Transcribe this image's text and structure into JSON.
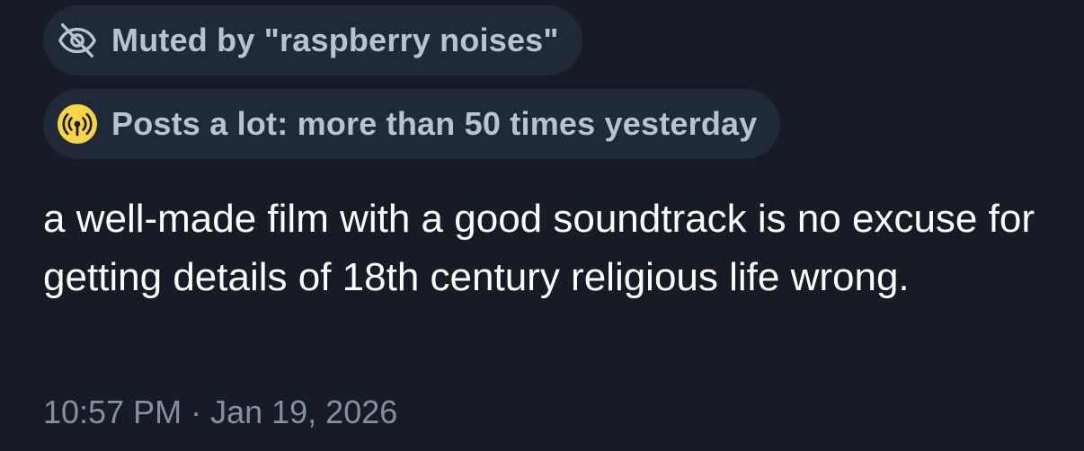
{
  "post": {
    "muted_label": "Muted by \"raspberry noises\"",
    "posts_a_lot_label": "Posts a lot: more than 50 times yesterday",
    "text": "a well-made film with a good soundtrack is no excuse for getting details of 18th century religious life wrong.",
    "timestamp": "10:57 PM · Jan 19, 2026"
  },
  "icons": {
    "muted": "eye-slash-icon",
    "posts_a_lot": "broadcast-icon"
  },
  "colors": {
    "background": "#161b26",
    "pill_background": "#1f2937",
    "pill_text": "#b8c3d2",
    "post_text": "#ffffff",
    "timestamp_text": "#8290a3",
    "broadcast_badge": "#f5d547"
  }
}
